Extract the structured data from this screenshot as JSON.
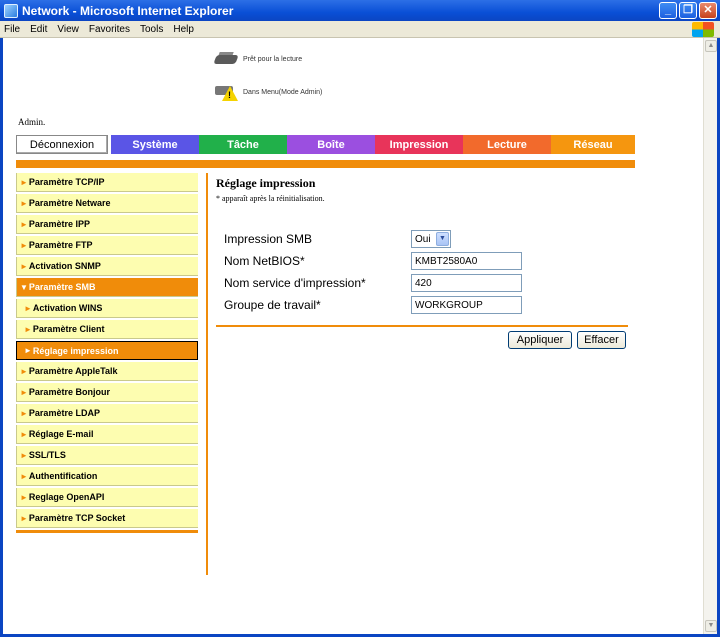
{
  "window": {
    "title": "Network - Microsoft Internet Explorer",
    "menu": [
      "File",
      "Edit",
      "View",
      "Favorites",
      "Tools",
      "Help"
    ],
    "menu_accel": [
      "F",
      "E",
      "V",
      "a",
      "T",
      "H"
    ]
  },
  "status": {
    "ready_text": "Prêt pour la lecture",
    "menu_text": "Dans Menu(Mode Admin)"
  },
  "admin_label": "Admin.",
  "tabs": [
    {
      "label": "Déconnexion",
      "color": "#ffffff"
    },
    {
      "label": "Système",
      "color": "#5a55e6"
    },
    {
      "label": "Tâche",
      "color": "#21b04a"
    },
    {
      "label": "Boîte",
      "color": "#9b4fe0"
    },
    {
      "label": "Impression",
      "color": "#e8345a"
    },
    {
      "label": "Lecture",
      "color": "#f26a2c"
    },
    {
      "label": "Réseau",
      "color": "#f5960f"
    }
  ],
  "sidebar": {
    "items": [
      {
        "label": "Paramètre TCP/IP",
        "state": "normal"
      },
      {
        "label": "Paramètre Netware",
        "state": "normal"
      },
      {
        "label": "Paramètre IPP",
        "state": "normal"
      },
      {
        "label": "Paramètre FTP",
        "state": "normal"
      },
      {
        "label": "Activation SNMP",
        "state": "normal"
      },
      {
        "label": "Paramètre SMB",
        "state": "expanded"
      },
      {
        "label": "Activation WINS",
        "state": "sub"
      },
      {
        "label": "Paramètre Client",
        "state": "sub"
      },
      {
        "label": "Réglage impression",
        "state": "current"
      },
      {
        "label": "Paramètre AppleTalk",
        "state": "normal"
      },
      {
        "label": "Paramètre Bonjour",
        "state": "normal"
      },
      {
        "label": "Paramètre LDAP",
        "state": "normal"
      },
      {
        "label": "Réglage E-mail",
        "state": "normal"
      },
      {
        "label": "SSL/TLS",
        "state": "normal"
      },
      {
        "label": "Authentification",
        "state": "normal"
      },
      {
        "label": "Reglage OpenAPI",
        "state": "normal"
      },
      {
        "label": "Paramètre TCP Socket",
        "state": "normal"
      }
    ]
  },
  "main": {
    "title": "Réglage impression",
    "note": "* apparaît après la réinitialisation.",
    "fields": [
      {
        "label": "Impression SMB",
        "value": "Oui"
      },
      {
        "label": "Nom NetBIOS*",
        "value": "KMBT2580A0"
      },
      {
        "label": "Nom service d'impression*",
        "value": "420"
      },
      {
        "label": "Groupe de travail*",
        "value": "WORKGROUP"
      }
    ],
    "apply_label": "Appliquer",
    "clear_label": "Effacer"
  },
  "colors": {
    "accent": "#f08c0a",
    "sidebar_bg": "#fdfdb0",
    "titlebar": "#0a4fd6"
  }
}
